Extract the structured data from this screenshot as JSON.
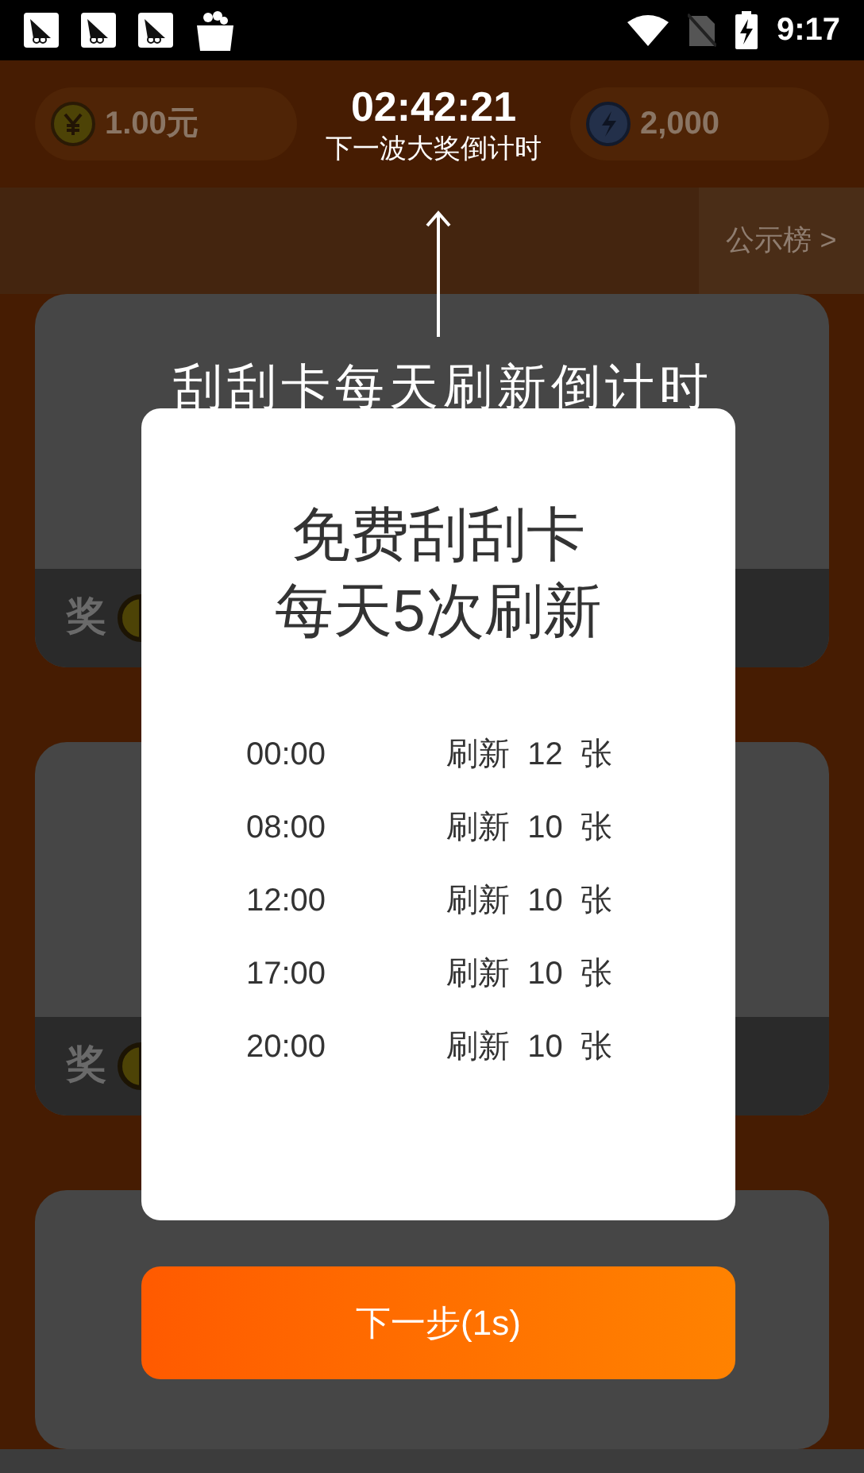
{
  "status_bar": {
    "time": "9:17"
  },
  "header": {
    "balance": "1.00元",
    "energy": "2,000",
    "countdown": "02:42:21",
    "countdown_label": "下一波大奖倒计时"
  },
  "notice_link": "公示榜 >",
  "cards": [
    {
      "kind": "prize",
      "label": "奖"
    },
    {
      "kind": "prize",
      "label": "奖"
    },
    {
      "kind": "cut"
    }
  ],
  "hint": "刮刮卡每天刷新倒计时",
  "dialog": {
    "title_lines": [
      "免费刮刮卡",
      "每天5次刷新"
    ],
    "schedule": [
      {
        "time": "00:00",
        "action": "刷新",
        "count": "12",
        "unit": "张"
      },
      {
        "time": "08:00",
        "action": "刷新",
        "count": "10",
        "unit": "张"
      },
      {
        "time": "12:00",
        "action": "刷新",
        "count": "10",
        "unit": "张"
      },
      {
        "time": "17:00",
        "action": "刷新",
        "count": "10",
        "unit": "张"
      },
      {
        "time": "20:00",
        "action": "刷新",
        "count": "10",
        "unit": "张"
      }
    ]
  },
  "next_button": "下一步(1s)"
}
